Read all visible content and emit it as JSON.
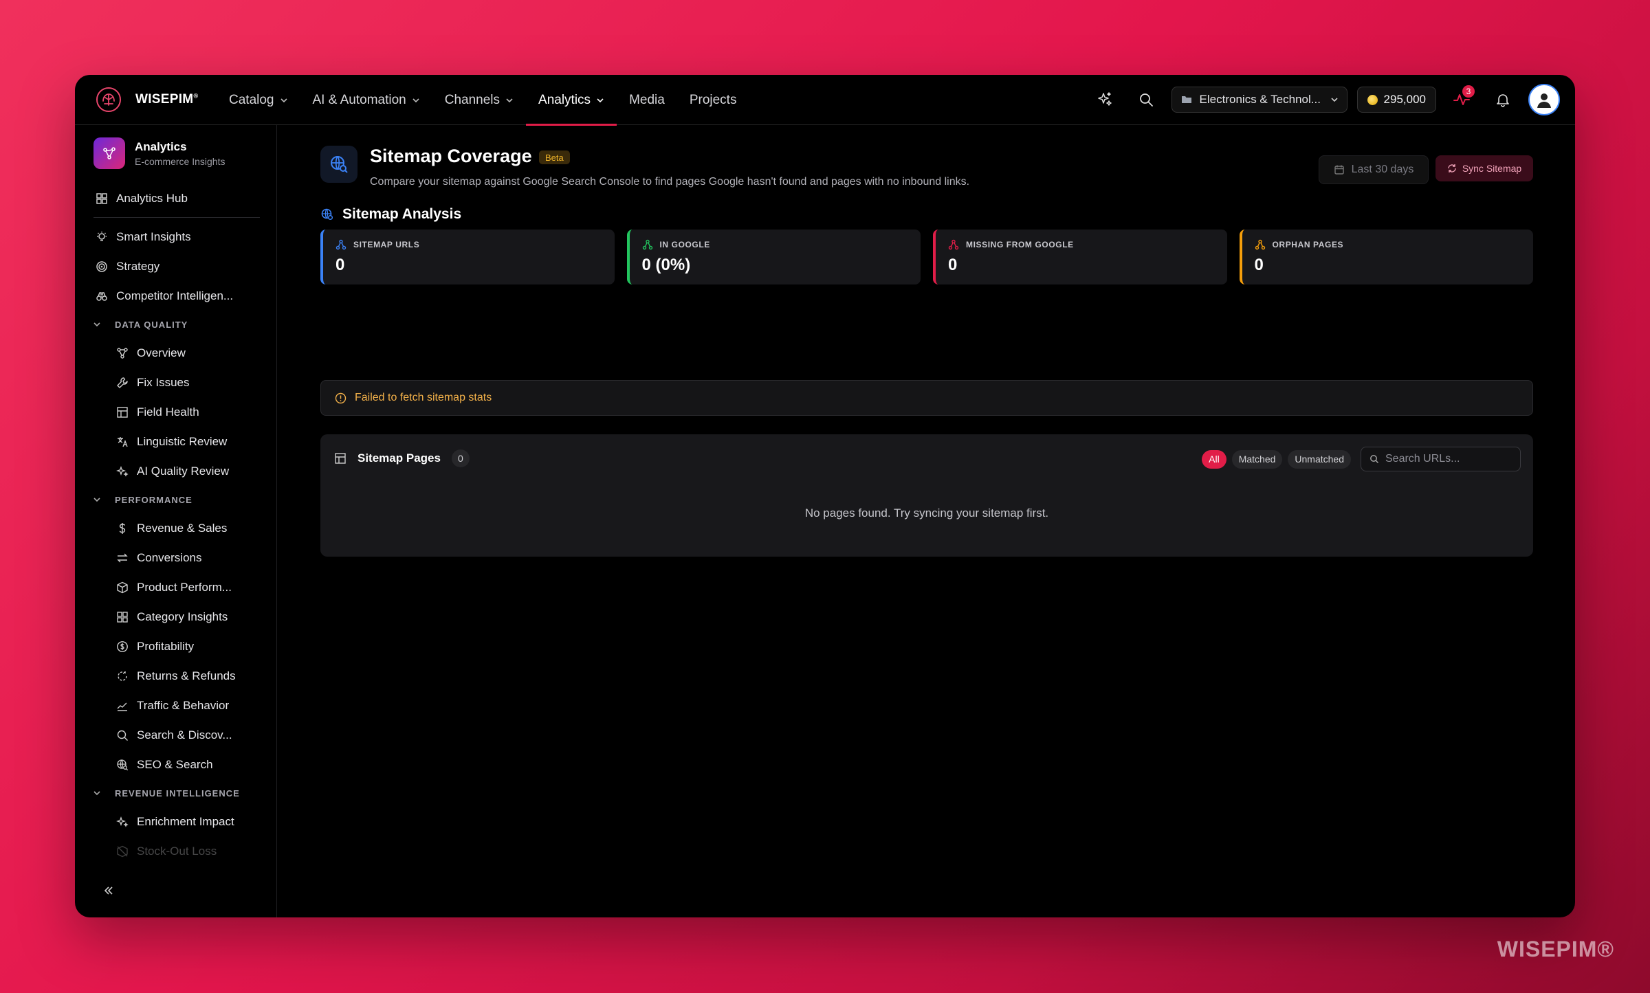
{
  "app": {
    "brand": "WISEPIM",
    "brand_mark": "®",
    "watermark": "WISEPIM®"
  },
  "nav": {
    "items": [
      {
        "label": "Catalog",
        "dropdown": true
      },
      {
        "label": "AI & Automation",
        "dropdown": true
      },
      {
        "label": "Channels",
        "dropdown": true
      },
      {
        "label": "Analytics",
        "dropdown": true,
        "active": true
      },
      {
        "label": "Media",
        "dropdown": false
      },
      {
        "label": "Projects",
        "dropdown": false
      }
    ]
  },
  "topbar": {
    "store": "Electronics & Technol...",
    "credits": "295,000",
    "activity_badge": "3"
  },
  "sidebar": {
    "title": "Analytics",
    "subtitle": "E-commerce Insights",
    "hub": "Analytics Hub",
    "top_items": [
      "Smart Insights",
      "Strategy",
      "Competitor Intelligen..."
    ],
    "sections": [
      {
        "label": "DATA QUALITY",
        "items": [
          "Overview",
          "Fix Issues",
          "Field Health",
          "Linguistic Review",
          "AI Quality Review"
        ]
      },
      {
        "label": "PERFORMANCE",
        "items": [
          "Revenue & Sales",
          "Conversions",
          "Product Perform...",
          "Category Insights",
          "Profitability",
          "Returns & Refunds",
          "Traffic & Behavior",
          "Search & Discov...",
          "SEO & Search"
        ]
      },
      {
        "label": "REVENUE INTELLIGENCE",
        "items": [
          "Enrichment Impact",
          "Stock-Out Loss"
        ]
      }
    ]
  },
  "page": {
    "title": "Sitemap Coverage",
    "badge": "Beta",
    "description": "Compare your sitemap against Google Search Console to find pages Google hasn't found and pages with no inbound links.",
    "date_range": "Last 30 days",
    "sync_label": "Sync Sitemap",
    "section_title": "Sitemap Analysis",
    "stats": [
      {
        "label": "SITEMAP URLS",
        "value": "0",
        "color": "#3b82f6"
      },
      {
        "label": "IN GOOGLE",
        "value": "0 (0%)",
        "color": "#22c55e"
      },
      {
        "label": "MISSING FROM GOOGLE",
        "value": "0",
        "color": "#e11d48"
      },
      {
        "label": "ORPHAN PAGES",
        "value": "0",
        "color": "#f59e0b"
      }
    ],
    "error": "Failed to fetch sitemap stats",
    "pages_card": {
      "title": "Sitemap Pages",
      "count": "0",
      "filters": [
        "All",
        "Matched",
        "Unmatched"
      ],
      "search_placeholder": "Search URLs...",
      "empty": "No pages found. Try syncing your sitemap first."
    }
  }
}
